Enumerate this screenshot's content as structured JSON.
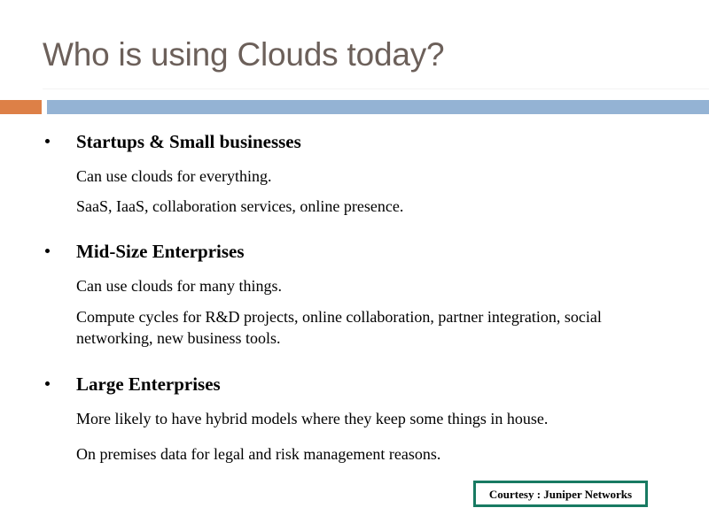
{
  "slide": {
    "title": "Who is using Clouds today?",
    "title_color": "#6c605a",
    "background_color": "#ffffff",
    "accent_block_color": "#dd8047",
    "accent_bar_color": "#94b3d4",
    "bullet_glyph": "•",
    "groups": [
      {
        "heading": "Startups & Small businesses",
        "lines": [
          "Can use clouds for everything.",
          "SaaS, IaaS, collaboration services, online presence."
        ]
      },
      {
        "heading": "Mid-Size Enterprises",
        "lines": [
          "Can use clouds for many things.",
          "Compute cycles for R&D projects, online collaboration, partner integration, social networking, new business tools."
        ]
      },
      {
        "heading": "Large Enterprises",
        "lines": [
          "More likely to have hybrid models where they keep some things in house.",
          "On premises data for legal and risk management reasons."
        ]
      }
    ],
    "credit": {
      "text": "Courtesy : Juniper Networks",
      "border_color": "#187a62"
    }
  }
}
